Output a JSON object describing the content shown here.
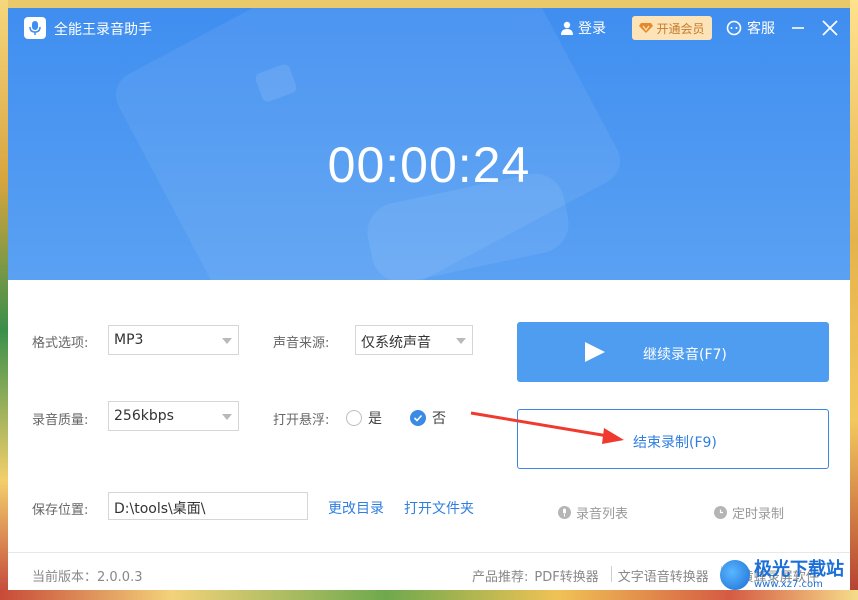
{
  "window": {
    "title": "全能王录音助手",
    "login_label": "登录",
    "vip_label": "开通会员",
    "service_label": "客服"
  },
  "timer": "00:00:24",
  "options": {
    "format_label": "格式选项:",
    "format_value": "MP3",
    "source_label": "声音来源:",
    "source_value": "仅系统声音",
    "quality_label": "录音质量:",
    "quality_value": "256kbps",
    "float_label": "打开悬浮:",
    "float_yes": "是",
    "float_no": "否",
    "float_selected": "否",
    "save_label": "保存位置:",
    "save_path": "D:\\tools\\桌面\\",
    "change_dir": "更改目录",
    "open_folder": "打开文件夹"
  },
  "actions": {
    "continue_label": "继续录音(F7)",
    "stop_label": "结束录制(F9)",
    "record_list": "录音列表",
    "timed_record": "定时录制"
  },
  "footer": {
    "version": "当前版本：2.0.0.3",
    "recommend_label": "产品推荐:",
    "pdf": "PDF转换器",
    "tts": "文字语音转换器",
    "screen": "大黄蜂录屏软件"
  },
  "watermark": {
    "name": "极光下载站",
    "url": "www.xz7.com"
  },
  "colors": {
    "accent": "#3f8ef0",
    "link": "#2f7fe0",
    "annotation": "#f03a2f"
  }
}
